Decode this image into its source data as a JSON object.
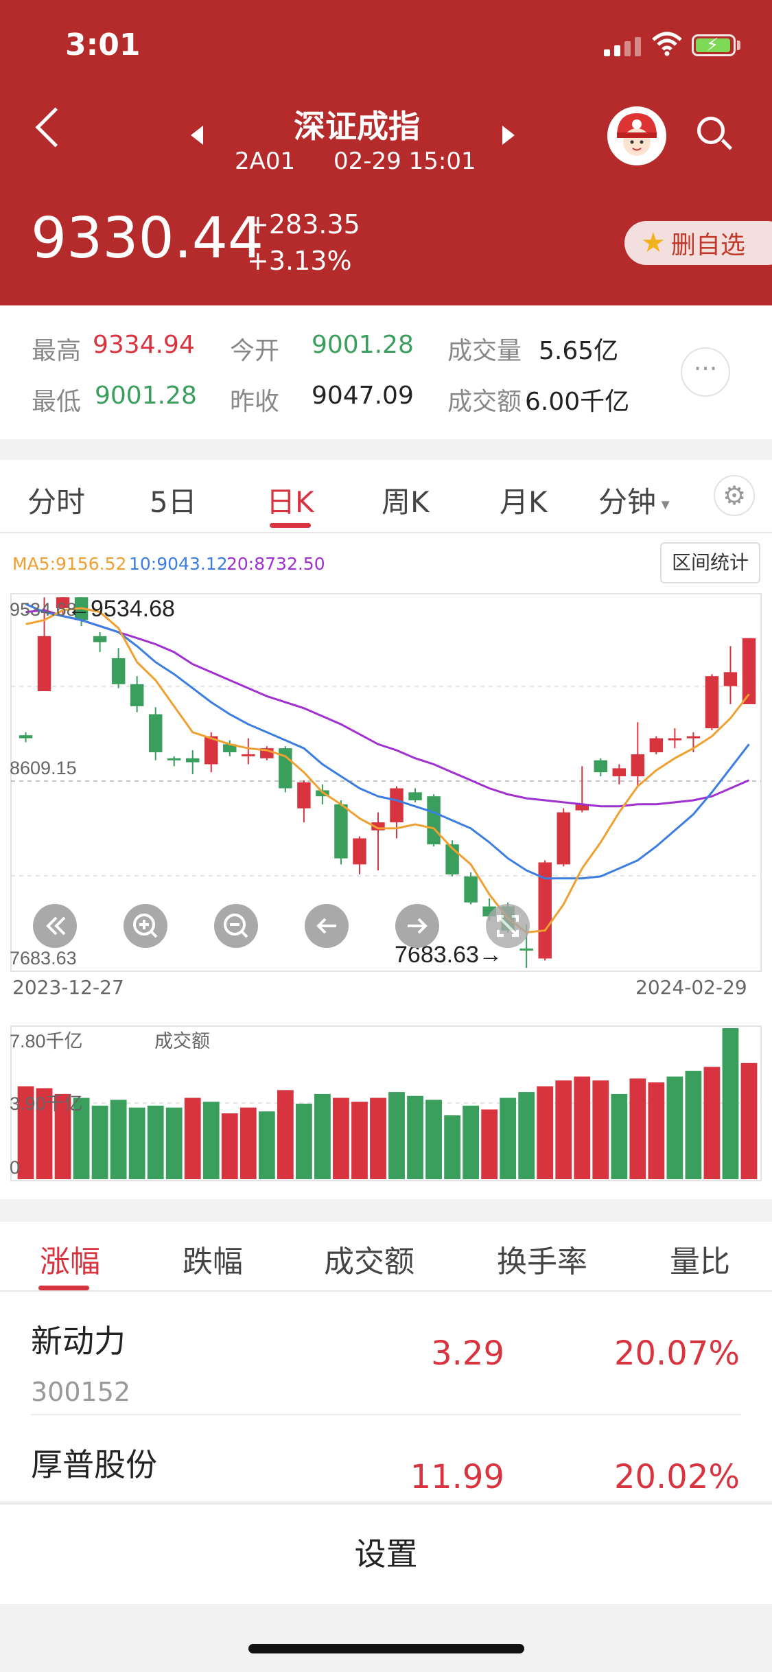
{
  "status_bar": {
    "time": "3:01"
  },
  "header": {
    "title": "深证成指",
    "code": "2A01",
    "datetime": "02-29 15:01",
    "price": "9330.44",
    "change": "+283.35",
    "change_pct": "+3.13%",
    "fav_button": "删自选"
  },
  "stats": {
    "high_label": "最高",
    "high": "9334.94",
    "low_label": "最低",
    "low": "9001.28",
    "open_label": "今开",
    "open": "9001.28",
    "prev_close_label": "昨收",
    "prev_close": "9047.09",
    "volume_label": "成交量",
    "volume": "5.65亿",
    "amount_label": "成交额",
    "amount": "6.00千亿",
    "more": "···"
  },
  "tabs": [
    "分时",
    "5日",
    "日K",
    "周K",
    "月K",
    "分钟"
  ],
  "active_tab": "日K",
  "chart_controls": {
    "interval_stats": "区间统计"
  },
  "colors": {
    "header_bg": "#b52a2a",
    "up": "#d8343f",
    "down": "#3a9e5c",
    "ma5": "#f0a030",
    "ma10": "#3b7de0",
    "ma20": "#a030d0"
  },
  "chart_data": [
    {
      "type": "candlestick",
      "ma_legend": {
        "ma5": "MA5:9156.52",
        "ma10": "10:9043.12",
        "ma20": "20:8732.50"
      },
      "y_labels": {
        "top": "9534.68",
        "mid": "8609.15",
        "bottom": "7683.63"
      },
      "annotations": {
        "high": "←9534.68",
        "low": "7683.63→"
      },
      "x_labels": {
        "start": "2023-12-27",
        "end": "2024-02-29"
      },
      "ylim": [
        7683.63,
        9534.68
      ],
      "candles": [
        {
          "o": 8845,
          "c": 8830,
          "h": 8860,
          "l": 8810
        },
        {
          "o": 9065,
          "c": 9340,
          "h": 9534,
          "l": 9300
        },
        {
          "o": 9480,
          "c": 9534,
          "h": 9534,
          "l": 9440
        },
        {
          "o": 9534,
          "c": 9420,
          "h": 9534,
          "l": 9390
        },
        {
          "o": 9340,
          "c": 9310,
          "h": 9360,
          "l": 9260
        },
        {
          "o": 9230,
          "c": 9100,
          "h": 9280,
          "l": 9080
        },
        {
          "o": 9100,
          "c": 8990,
          "h": 9140,
          "l": 8960
        },
        {
          "o": 8950,
          "c": 8760,
          "h": 8985,
          "l": 8720
        },
        {
          "o": 8730,
          "c": 8720,
          "h": 8740,
          "l": 8690
        },
        {
          "o": 8730,
          "c": 8710,
          "h": 8770,
          "l": 8650
        },
        {
          "o": 8700,
          "c": 8840,
          "h": 8860,
          "l": 8660
        },
        {
          "o": 8800,
          "c": 8760,
          "h": 8820,
          "l": 8740
        },
        {
          "o": 8750,
          "c": 8750,
          "h": 8830,
          "l": 8700
        },
        {
          "o": 8730,
          "c": 8780,
          "h": 8790,
          "l": 8720
        },
        {
          "o": 8780,
          "c": 8580,
          "h": 8790,
          "l": 8560
        },
        {
          "o": 8480,
          "c": 8610,
          "h": 8620,
          "l": 8410
        },
        {
          "o": 8570,
          "c": 8540,
          "h": 8600,
          "l": 8500
        },
        {
          "o": 8500,
          "c": 8230,
          "h": 8520,
          "l": 8200
        },
        {
          "o": 8200,
          "c": 8330,
          "h": 8340,
          "l": 8150
        },
        {
          "o": 8370,
          "c": 8410,
          "h": 8460,
          "l": 8170
        },
        {
          "o": 8410,
          "c": 8580,
          "h": 8590,
          "l": 8330
        },
        {
          "o": 8560,
          "c": 8520,
          "h": 8580,
          "l": 8510
        },
        {
          "o": 8540,
          "c": 8300,
          "h": 8550,
          "l": 8290
        },
        {
          "o": 8300,
          "c": 8150,
          "h": 8320,
          "l": 8140
        },
        {
          "o": 8140,
          "c": 8010,
          "h": 8160,
          "l": 8000
        },
        {
          "o": 7990,
          "c": 7940,
          "h": 8030,
          "l": 7920
        },
        {
          "o": 7990,
          "c": 7870,
          "h": 8010,
          "l": 7860
        },
        {
          "o": 7780,
          "c": 7770,
          "h": 7900,
          "l": 7683
        },
        {
          "o": 7730,
          "c": 8210,
          "h": 8220,
          "l": 7720
        },
        {
          "o": 8200,
          "c": 8460,
          "h": 8480,
          "l": 8190
        },
        {
          "o": 8470,
          "c": 8500,
          "h": 8690,
          "l": 8460
        },
        {
          "o": 8720,
          "c": 8660,
          "h": 8730,
          "l": 8640
        },
        {
          "o": 8640,
          "c": 8680,
          "h": 8700,
          "l": 8600
        },
        {
          "o": 8640,
          "c": 8750,
          "h": 8910,
          "l": 8590
        },
        {
          "o": 8760,
          "c": 8830,
          "h": 8840,
          "l": 8750
        },
        {
          "o": 8830,
          "c": 8830,
          "h": 8880,
          "l": 8780
        },
        {
          "o": 8830,
          "c": 8840,
          "h": 8860,
          "l": 8760
        },
        {
          "o": 8880,
          "c": 9140,
          "h": 9150,
          "l": 8870
        },
        {
          "o": 9090,
          "c": 9160,
          "h": 9290,
          "l": 9000
        },
        {
          "o": 9000,
          "c": 9330,
          "h": 9330,
          "l": 9000
        }
      ],
      "ma5": [
        9400,
        9420,
        9470,
        9480,
        9460,
        9380,
        9210,
        9120,
        8990,
        8860,
        8830,
        8800,
        8780,
        8770,
        8740,
        8660,
        8560,
        8500,
        8430,
        8380,
        8380,
        8400,
        8380,
        8280,
        8200,
        8050,
        7930,
        7860,
        7870,
        8000,
        8180,
        8310,
        8460,
        8590,
        8670,
        8730,
        8780,
        8840,
        8930,
        9050
      ],
      "ma10": [
        9500,
        9460,
        9440,
        9420,
        9390,
        9360,
        9290,
        9210,
        9150,
        9080,
        9010,
        8950,
        8900,
        8860,
        8820,
        8780,
        8700,
        8640,
        8580,
        8540,
        8520,
        8490,
        8460,
        8420,
        8380,
        8310,
        8230,
        8170,
        8130,
        8130,
        8130,
        8140,
        8180,
        8220,
        8290,
        8370,
        8450,
        8560,
        8680,
        8800
      ],
      "ma20": [
        9460,
        9470,
        9440,
        9420,
        9390,
        9360,
        9330,
        9300,
        9260,
        9200,
        9160,
        9120,
        9080,
        9040,
        9010,
        8980,
        8940,
        8900,
        8850,
        8800,
        8770,
        8730,
        8700,
        8660,
        8620,
        8580,
        8550,
        8530,
        8520,
        8510,
        8500,
        8490,
        8490,
        8500,
        8500,
        8510,
        8520,
        8540,
        8580,
        8620
      ]
    },
    {
      "type": "bar",
      "title": "成交额",
      "y_labels": {
        "top": "7.80千亿",
        "mid": "3.90千亿",
        "bottom": "0"
      },
      "ylim": [
        0,
        7.8
      ],
      "values": [
        4.8,
        4.7,
        4.4,
        4.2,
        3.8,
        4.1,
        3.7,
        3.8,
        3.7,
        4.2,
        4.0,
        3.4,
        3.7,
        3.5,
        4.6,
        3.9,
        4.4,
        4.2,
        4.0,
        4.2,
        4.5,
        4.3,
        4.1,
        3.3,
        3.8,
        3.6,
        4.2,
        4.5,
        4.8,
        5.1,
        5.3,
        5.1,
        4.4,
        5.2,
        5.0,
        5.3,
        5.6,
        5.8,
        7.8,
        6.0
      ],
      "up": [
        true,
        true,
        true,
        false,
        false,
        false,
        false,
        false,
        false,
        true,
        false,
        true,
        true,
        false,
        true,
        false,
        false,
        true,
        true,
        true,
        false,
        false,
        false,
        false,
        false,
        true,
        false,
        false,
        true,
        true,
        true,
        true,
        false,
        true,
        true,
        false,
        false,
        true,
        false,
        true
      ]
    }
  ],
  "list_tabs": [
    "涨幅",
    "跌幅",
    "成交额",
    "换手率",
    "量比"
  ],
  "list": [
    {
      "name": "新动力",
      "code": "300152",
      "price": "3.29",
      "pct": "20.07%"
    },
    {
      "name": "厚普股份",
      "code": "",
      "price": "11.99",
      "pct": "20.02%"
    }
  ],
  "settings": "设置"
}
